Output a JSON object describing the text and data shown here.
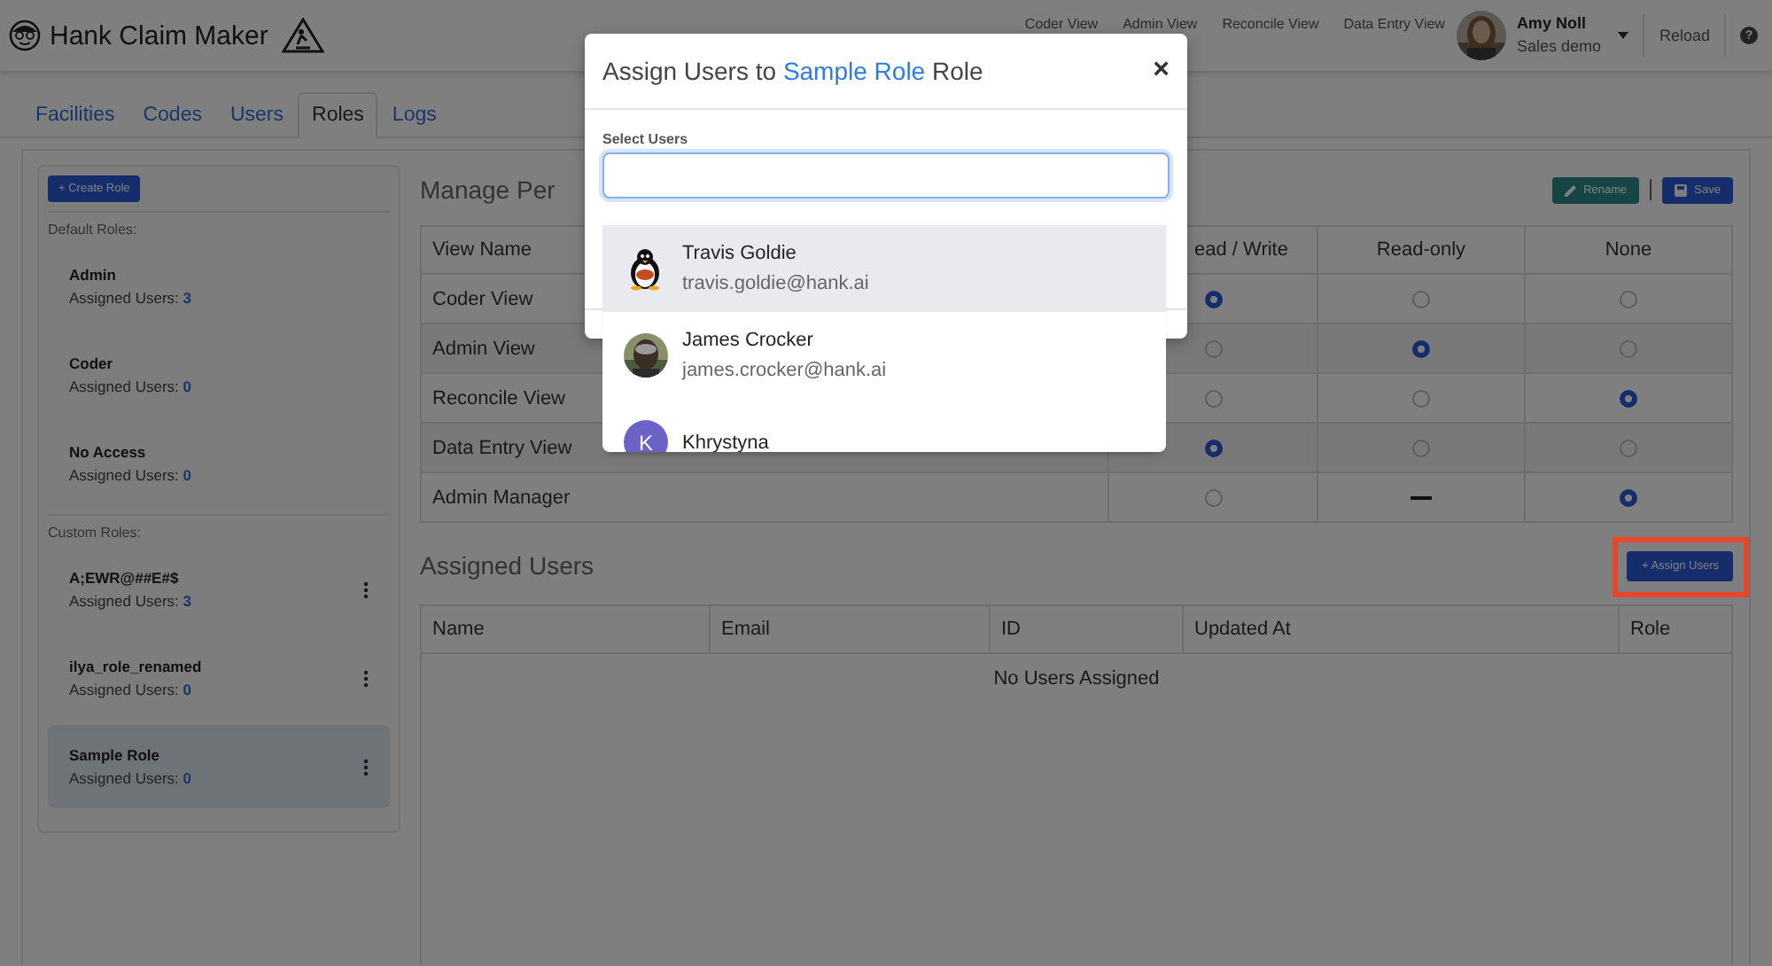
{
  "app": {
    "title": "Hank Claim Maker",
    "nav": [
      "Coder View",
      "Admin View",
      "Reconcile View",
      "Data Entry View"
    ],
    "user": {
      "name": "Amy Noll",
      "org": "Sales demo"
    },
    "reload": "Reload",
    "help": "?"
  },
  "tabs": [
    {
      "label": "Facilities",
      "selected": false
    },
    {
      "label": "Codes",
      "selected": false
    },
    {
      "label": "Users",
      "selected": false
    },
    {
      "label": "Roles",
      "selected": true
    },
    {
      "label": "Logs",
      "selected": false
    }
  ],
  "sidebar": {
    "create_button": "+ Create Role",
    "sections": [
      {
        "title": "Default Roles:",
        "roles": [
          {
            "name": "Admin",
            "count_label": "Assigned Users:",
            "count": "3",
            "selected": false,
            "menu": false
          },
          {
            "name": "Coder",
            "count_label": "Assigned Users:",
            "count": "0",
            "selected": false,
            "menu": false
          },
          {
            "name": "No Access",
            "count_label": "Assigned Users:",
            "count": "0",
            "selected": false,
            "menu": false
          }
        ]
      },
      {
        "title": "Custom Roles:",
        "roles": [
          {
            "name": "A;EWR@##E#$",
            "count_label": "Assigned Users:",
            "count": "3",
            "selected": false,
            "menu": true
          },
          {
            "name": "ilya_role_renamed",
            "count_label": "Assigned Users:",
            "count": "0",
            "selected": false,
            "menu": true
          },
          {
            "name": "Sample Role",
            "count_label": "Assigned Users:",
            "count": "0",
            "selected": true,
            "menu": true
          }
        ]
      }
    ]
  },
  "permissions": {
    "heading": "Manage Per",
    "rename": "Rename",
    "save": "Save",
    "columns": [
      "View Name",
      "ead / Write",
      "Read-only",
      "None"
    ],
    "rows": [
      {
        "name": "Coder View",
        "options": [
          {
            "kind": "radio",
            "selected": true
          },
          {
            "kind": "radio",
            "selected": false
          },
          {
            "kind": "radio",
            "selected": false
          }
        ]
      },
      {
        "name": "Admin View",
        "options": [
          {
            "kind": "radio",
            "selected": false
          },
          {
            "kind": "radio",
            "selected": true
          },
          {
            "kind": "radio",
            "selected": false
          }
        ]
      },
      {
        "name": "Reconcile View",
        "options": [
          {
            "kind": "radio",
            "selected": false
          },
          {
            "kind": "radio",
            "selected": false
          },
          {
            "kind": "radio",
            "selected": true
          }
        ]
      },
      {
        "name": "Data Entry View",
        "options": [
          {
            "kind": "radio",
            "selected": true
          },
          {
            "kind": "radio",
            "selected": false
          },
          {
            "kind": "radio",
            "selected": false
          }
        ]
      },
      {
        "name": "Admin Manager",
        "options": [
          {
            "kind": "radio",
            "selected": false
          },
          {
            "kind": "unavailable"
          },
          {
            "kind": "radio",
            "selected": true
          }
        ]
      }
    ]
  },
  "assigned": {
    "heading": "Assigned Users",
    "button": "+ Assign Users",
    "highlighted": true,
    "columns": [
      "Name",
      "Email",
      "ID",
      "Updated At",
      "Role"
    ],
    "empty": "No Users Assigned"
  },
  "modal": {
    "title_prefix": "Assign Users to",
    "role": "Sample Role",
    "title_suffix": "Role",
    "close": "×",
    "field_label": "Select Users",
    "options": [
      {
        "name": "Travis Goldie",
        "email": "travis.goldie@hank.ai",
        "kind": "penguin",
        "selected": true
      },
      {
        "name": "James Crocker",
        "email": "james.crocker@hank.ai",
        "selected": false
      },
      {
        "name": "Khrystyna",
        "kind": "letter",
        "letter": "K",
        "selected": false
      }
    ]
  }
}
